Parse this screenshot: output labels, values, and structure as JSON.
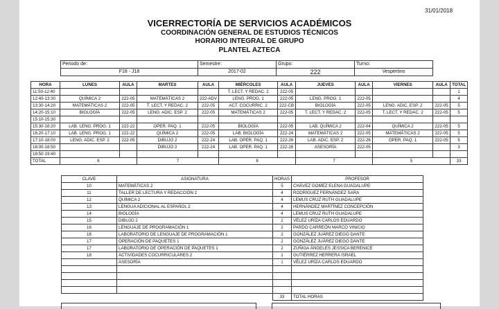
{
  "date": "31/01/2018",
  "header": {
    "line1": "VICERRECTORÍA DE SERVICIOS ACADÉMICOS",
    "line2": "COORDINACIÓN GENERAL DE ESTUDIOS TÉCNICOS",
    "line3": "HORARIO INTEGRAL DE GRUPO",
    "line4": "PLANTEL AZTECA"
  },
  "meta": {
    "periodo_label": "Periodo de:",
    "periodo_value": "F18 - J18",
    "semestre_label": "Semestre:",
    "semestre_value": "2017-02",
    "grupo_label": "Grupo:",
    "grupo_value": "222",
    "turno_label": "Turno:",
    "turno_value": "Vespertino"
  },
  "schedule": {
    "headers": [
      "HORA",
      "LUNES",
      "AULA",
      "MARTES",
      "AULA",
      "MIÉRCOLES",
      "AULA",
      "JUEVES",
      "AULA",
      "VIERNES",
      "AULA",
      "TOTAL"
    ],
    "rows": [
      [
        "11:50-12:40",
        "",
        "",
        "",
        "",
        "T. LECT. Y REDAC. 2",
        "222-05",
        "",
        "",
        "",
        "",
        "1"
      ],
      [
        "12:40-13:30",
        "QUÍMICA 2",
        "222-05",
        "MATEMÁTICAS 2",
        "222-ADV",
        "LENG. PROG. 1",
        "222-05",
        "LENG. PROG. 1",
        "222-05",
        "",
        "",
        "4"
      ],
      [
        "13:30-14:20",
        "MATEMÁTICAS 2",
        "222-05",
        "T. LECT. Y REDAC. 2",
        "222-05",
        "ACT. COCURRIC. 2",
        "222-CB",
        "BIOLOGÍA",
        "222-05",
        "LENG. ADIC. ESP. 2",
        "222-05",
        "5"
      ],
      [
        "14:20-15:10",
        "BIOLOGÍA",
        "222-05",
        "LENG. ADIC. ESP. 2",
        "222-05",
        "MATEMÁTICAS 2",
        "222-05",
        "T. LECT. Y REDAC. 2",
        "222-05",
        "T. LECT. Y REDAC. 2",
        "222-05",
        "5"
      ],
      [
        "15:10-15:30",
        "",
        "",
        "",
        "",
        "",
        "",
        "",
        "",
        "",
        "",
        ""
      ],
      [
        "15:30-16:20",
        "LAB. LENG. PROG. 1",
        "222-22",
        "OPER. PAQ. 1",
        "222-05",
        "BIOLOGÍA",
        "222-05",
        "LAB. QUÍMICA 2",
        "222-04",
        "QUÍMICA 2",
        "222-05",
        "5"
      ],
      [
        "16:20-17:10",
        "LAB. LENG. PROG. 1",
        "222-22",
        "QUÍMICA 2",
        "222-05",
        "LAB. BIOLOGÍA",
        "222-24",
        "MATEMÁTICAS 2",
        "222-05",
        "MATEMÁTICAS 2",
        "222-05",
        "5"
      ],
      [
        "17:10-18:00",
        "LENG. ADIC. ESP. 2",
        "222-05",
        "DIBUJO 2",
        "222-24",
        "LAB. OPER. PAQ. 1",
        "222-26",
        "LAB. ADIC. ESP. 2",
        "222-26",
        "OPER. PAQ. 1",
        "222-05",
        "5"
      ],
      [
        "18:00-18:50",
        "",
        "",
        "DIBUJO 2",
        "222-24",
        "LAB. OPER. PAQ. 1",
        "222-26",
        "ASESORÍA",
        "222-05",
        "",
        "",
        "3"
      ],
      [
        "18:50-19:40",
        "",
        "",
        "",
        "",
        "",
        "",
        "",
        "",
        "",
        "",
        ""
      ]
    ],
    "total_label": "TOTAL",
    "totals": [
      "6",
      "7",
      "8",
      "7",
      "5",
      "33"
    ]
  },
  "subjects": {
    "headers": [
      "CLAVE",
      "ASIGNATURA",
      "HORAS",
      "PROFESOR"
    ],
    "rows": [
      [
        "10",
        "MATEMÁTICAS 2",
        "5",
        "CHÁVEZ GOMEZ ELENA GUADALUPE"
      ],
      [
        "11",
        "TALLER DE LECTURA Y REDACCIÓN 2",
        "4",
        "RODRÍGUEZ FERNÁNDEZ SARA"
      ],
      [
        "12",
        "QUÍMICA 2",
        "4",
        "LEMUS CRUZ RUTH GUADALUPE"
      ],
      [
        "13",
        "LENGUA ADICIONAL AL ESPAÑOL 2",
        "4",
        "HERNÁNDEZ MARTÍNEZ CONCEPCIÓN"
      ],
      [
        "14",
        "BIOLOGÍA",
        "4",
        "LEMUS CRUZ RUTH GUADALUPE"
      ],
      [
        "15",
        "DIBUJO 2",
        "2",
        "VÉLEZ URÍZA CARLOS EDUARDO"
      ],
      [
        "16",
        "LENGUAJE DE PROGRAMACIÓN 1",
        "2",
        "PARDO CARREÓN MARCO VINICIO"
      ],
      [
        "16",
        "LABORATORIO DE LENGUAJE DE PROGRAMACIÓN 1",
        "2",
        "GONZÁLEZ JUÁREZ DIEGO DANTE"
      ],
      [
        "17",
        "OPERACIÓN DE PAQUETES 1",
        "2",
        "GONZÁLEZ JUÁREZ DIEGO DANTE"
      ],
      [
        "17",
        "LABORATORIO DE OPERACIÓN DE PAQUETES 1",
        "2",
        "ZÚÑIGA ÁNGELES JESSICA BERENICE"
      ],
      [
        "18",
        "ACTIVIDADES COCURRICULARES 2",
        "1",
        "GUTIÉRREZ HERRERA ISRAEL"
      ],
      [
        "",
        "ASESORÍA",
        "1",
        "VÉLEZ URÍZA CARLOS EDUARDO"
      ],
      [
        "",
        "",
        "",
        ""
      ],
      [
        "",
        "",
        "",
        ""
      ],
      [
        "",
        "",
        "",
        ""
      ],
      [
        "",
        "",
        "",
        ""
      ]
    ],
    "total_hours": "33",
    "total_label": "TOTAL HORAS"
  }
}
